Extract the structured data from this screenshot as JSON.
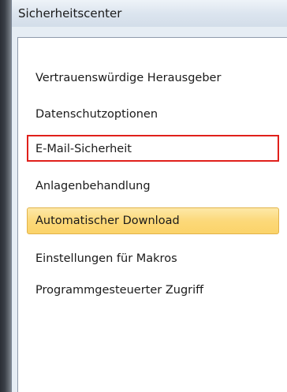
{
  "window": {
    "title": "Sicherheitscenter"
  },
  "nav": {
    "items": [
      {
        "label": "Vertrauenswürdige Herausgeber",
        "state": "normal"
      },
      {
        "label": "Datenschutzoptionen",
        "state": "normal"
      },
      {
        "label": "E-Mail-Sicherheit",
        "state": "highlighted"
      },
      {
        "label": "Anlagenbehandlung",
        "state": "normal"
      },
      {
        "label": "Automatischer Download",
        "state": "selected"
      },
      {
        "label": "Einstellungen für Makros",
        "state": "normal"
      },
      {
        "label": "Programmgesteuerter Zugriff",
        "state": "normal"
      }
    ]
  },
  "colors": {
    "highlight_border": "#e0201b",
    "selected_background": "#fcd97a"
  }
}
